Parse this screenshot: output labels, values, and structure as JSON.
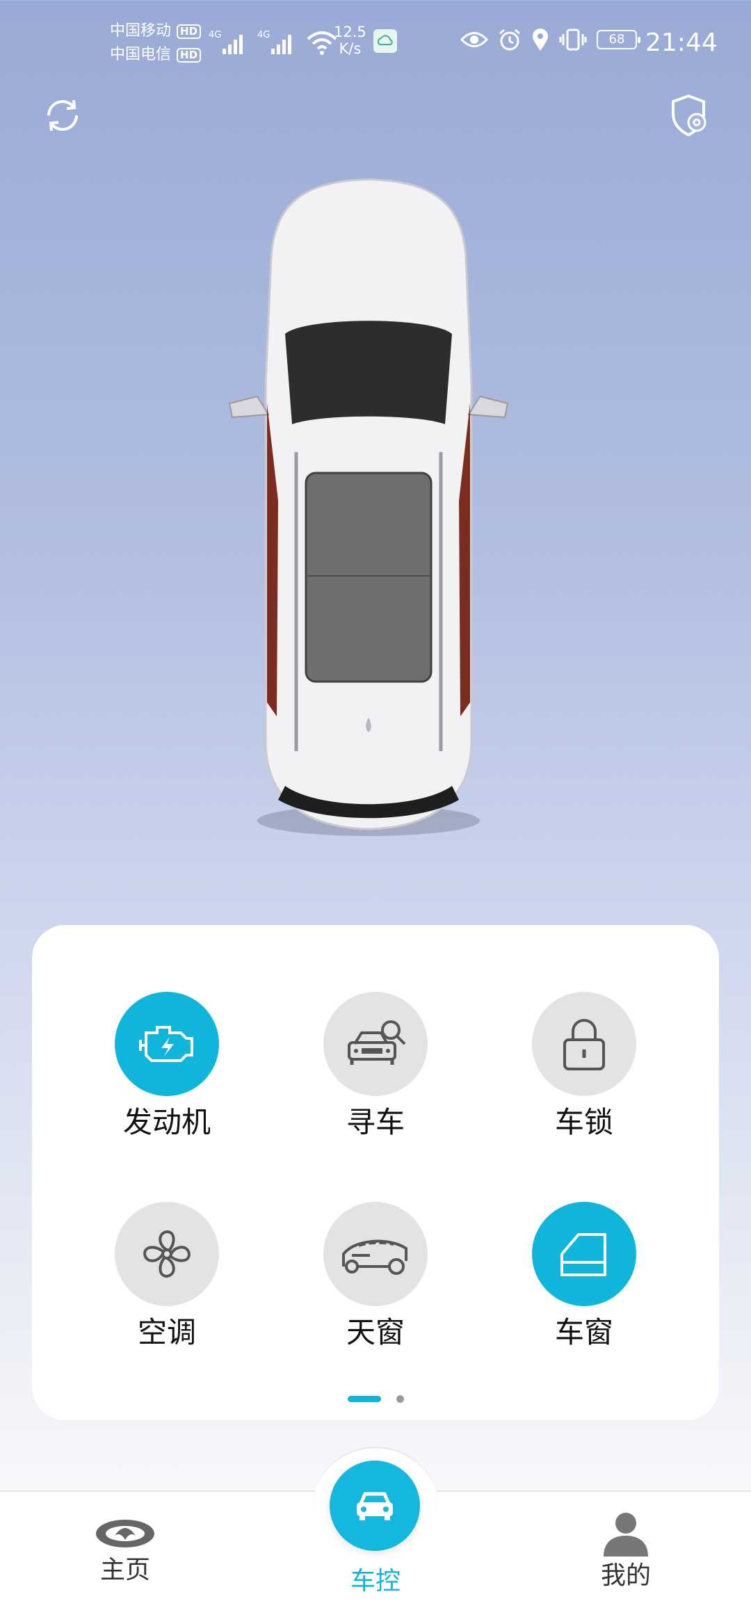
{
  "status_bar": {
    "carrier_1": "中国移动",
    "carrier_2": "中国电信",
    "hd_badge": "HD",
    "network_type_1": "4G",
    "network_type_2": "4G",
    "net_speed_value": "12.5",
    "net_speed_unit": "K/s",
    "battery_level": "68",
    "time": "21:44",
    "icons": [
      "eye-comfort-icon",
      "alarm-icon",
      "location-icon",
      "vibrate-icon",
      "battery-icon"
    ]
  },
  "header": {
    "left_icon": "refresh-icon",
    "right_icon": "shield-settings-icon"
  },
  "controls": {
    "page_index": 0,
    "page_count": 2,
    "items": [
      {
        "label": "发动机",
        "icon": "engine-icon",
        "active": true
      },
      {
        "label": "寻车",
        "icon": "find-car-icon",
        "active": false
      },
      {
        "label": "车锁",
        "icon": "lock-icon",
        "active": false
      },
      {
        "label": "空调",
        "icon": "fan-icon",
        "active": false
      },
      {
        "label": "天窗",
        "icon": "sunroof-icon",
        "active": false
      },
      {
        "label": "车窗",
        "icon": "car-window-icon",
        "active": true
      }
    ]
  },
  "bottom_nav": {
    "home_label": "主页",
    "control_label": "车控",
    "profile_label": "我的",
    "active_tab": "车控"
  },
  "colors": {
    "accent": "#0fb5da",
    "inactive_circle": "#e3e3e3",
    "bg_top": "#9aaad6"
  }
}
